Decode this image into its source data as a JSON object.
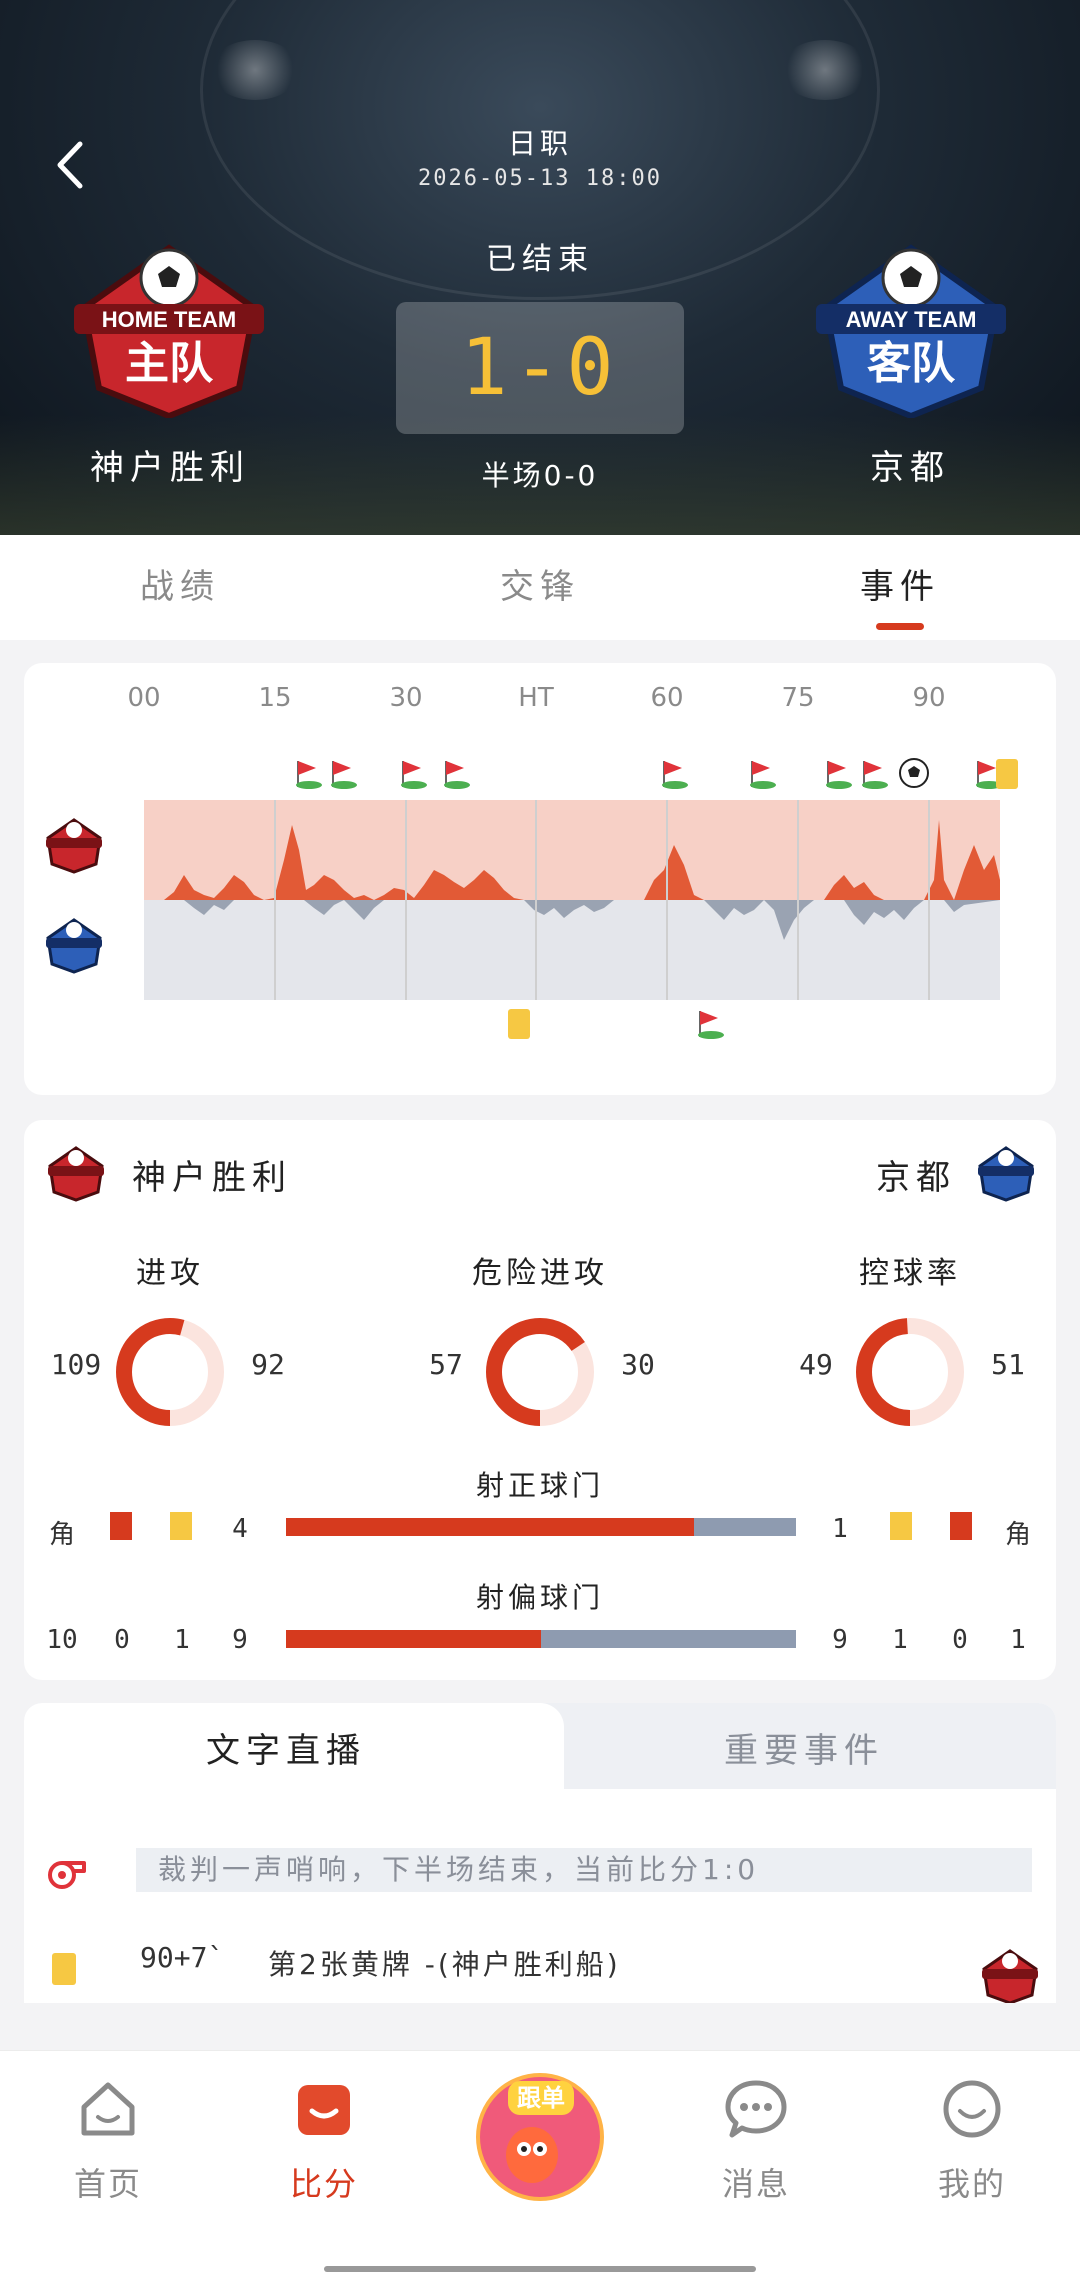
{
  "header": {
    "league": "日职",
    "datetime": "2026-05-13 18:00",
    "status": "已结束",
    "score": "1-0",
    "halftime": "半场0-0",
    "home": {
      "name": "神户胜利",
      "logo_top": "HOME TEAM",
      "logo_main": "主队"
    },
    "away": {
      "name": "京都",
      "logo_top": "AWAY TEAM",
      "logo_main": "客队"
    }
  },
  "tabs": [
    {
      "label": "战绩",
      "active": false
    },
    {
      "label": "交锋",
      "active": false
    },
    {
      "label": "事件",
      "active": true
    }
  ],
  "timeline": {
    "ticks": [
      "00",
      "15",
      "30",
      "HT",
      "60",
      "75",
      "90"
    ],
    "home_color": "#e25a36",
    "away_color": "#9aa3b2"
  },
  "stats": {
    "home_name": "神户胜利",
    "away_name": "京都",
    "donuts": [
      {
        "label": "进攻",
        "home": "109",
        "away": "92",
        "home_value": 109,
        "away_value": 92
      },
      {
        "label": "危险进攻",
        "home": "57",
        "away": "30",
        "home_value": 57,
        "away_value": 30
      },
      {
        "label": "控球率",
        "home": "49",
        "away": "51",
        "home_value": 49,
        "away_value": 51
      }
    ],
    "on_target": {
      "label": "射正球门",
      "home_corner": "角",
      "home": "4",
      "away": "1",
      "away_corner": "角",
      "home_share": 0.8
    },
    "off_target": {
      "label": "射偏球门",
      "home_values": [
        "10",
        "0",
        "1",
        "9"
      ],
      "away_values": [
        "9",
        "1",
        "0",
        "1"
      ],
      "home_share": 0.5
    }
  },
  "live": {
    "tabs": [
      "文字直播",
      "重要事件"
    ],
    "message": "裁判一声哨响，下半场结束，当前比分1:0",
    "event_time": "90+7`",
    "event_text": "第2张黄牌 -(神户胜利船)"
  },
  "nav": [
    {
      "label": "首页",
      "icon": "home-face-icon",
      "active": false
    },
    {
      "label": "比分",
      "icon": "score-icon",
      "active": true
    },
    {
      "label": "跟单",
      "icon": "follow-mascot-icon",
      "active": false
    },
    {
      "label": "消息",
      "icon": "message-icon",
      "active": false
    },
    {
      "label": "我的",
      "icon": "profile-icon",
      "active": false
    }
  ],
  "colors": {
    "accent": "#d63a1e",
    "score": "#f6c037",
    "card_yellow": "#f6c843"
  }
}
